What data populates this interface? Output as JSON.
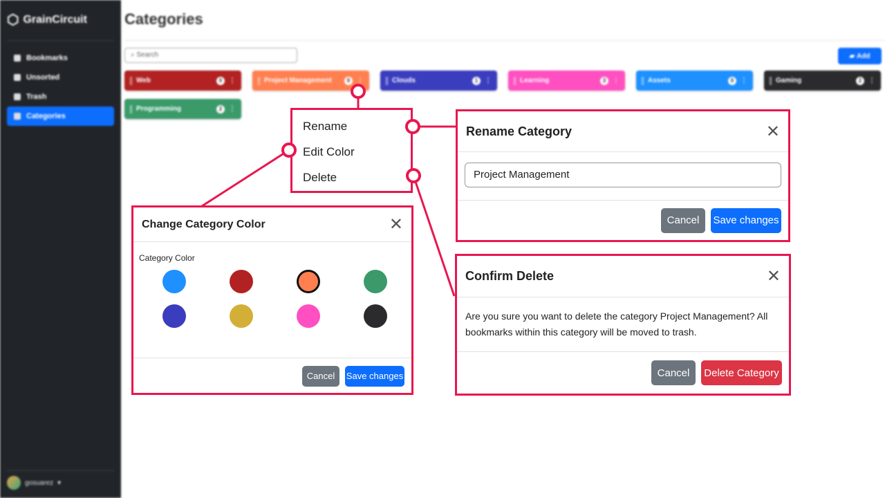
{
  "app": {
    "brand": "GrainCircuit",
    "user": "gosuarez"
  },
  "sidebar": {
    "items": [
      {
        "label": "Bookmarks",
        "icon": "bookmark-icon"
      },
      {
        "label": "Unsorted",
        "icon": "inbox-icon"
      },
      {
        "label": "Trash",
        "icon": "trash-icon"
      },
      {
        "label": "Categories",
        "icon": "briefcase-icon",
        "active": true
      }
    ]
  },
  "main": {
    "title": "Categories",
    "search_placeholder": "Search",
    "add_label": "Add",
    "categories": [
      {
        "name": "Web",
        "count": "0",
        "color": "#b22222"
      },
      {
        "name": "Project Management",
        "count": "0",
        "color": "#ff7f50"
      },
      {
        "name": "Clouds",
        "count": "1",
        "color": "#3b3dbf"
      },
      {
        "name": "Learning",
        "count": "3",
        "color": "#ff4fc1"
      },
      {
        "name": "Assets",
        "count": "0",
        "color": "#1e90ff"
      },
      {
        "name": "Gaming",
        "count": "2",
        "color": "#2b2b2e"
      },
      {
        "name": "Programming",
        "count": "2",
        "color": "#3a9a6a"
      }
    ]
  },
  "menu": {
    "items": [
      "Rename",
      "Edit Color",
      "Delete"
    ]
  },
  "rename_modal": {
    "title": "Rename Category",
    "value": "Project Management",
    "cancel": "Cancel",
    "save": "Save changes"
  },
  "color_modal": {
    "title": "Change Category Color",
    "label": "Category Color",
    "colors": [
      "#1e90ff",
      "#b22222",
      "#ff7f50",
      "#3a9a6a",
      "#3b3dbf",
      "#d4af37",
      "#ff4fc1",
      "#2b2b2e"
    ],
    "selected": "#ff7f50",
    "cancel": "Cancel",
    "save": "Save changes"
  },
  "delete_modal": {
    "title": "Confirm Delete",
    "message": "Are you sure you want to delete the category Project Management? All bookmarks within this category will be moved to trash.",
    "cancel": "Cancel",
    "confirm": "Delete Category"
  },
  "accent": "#e8174f"
}
